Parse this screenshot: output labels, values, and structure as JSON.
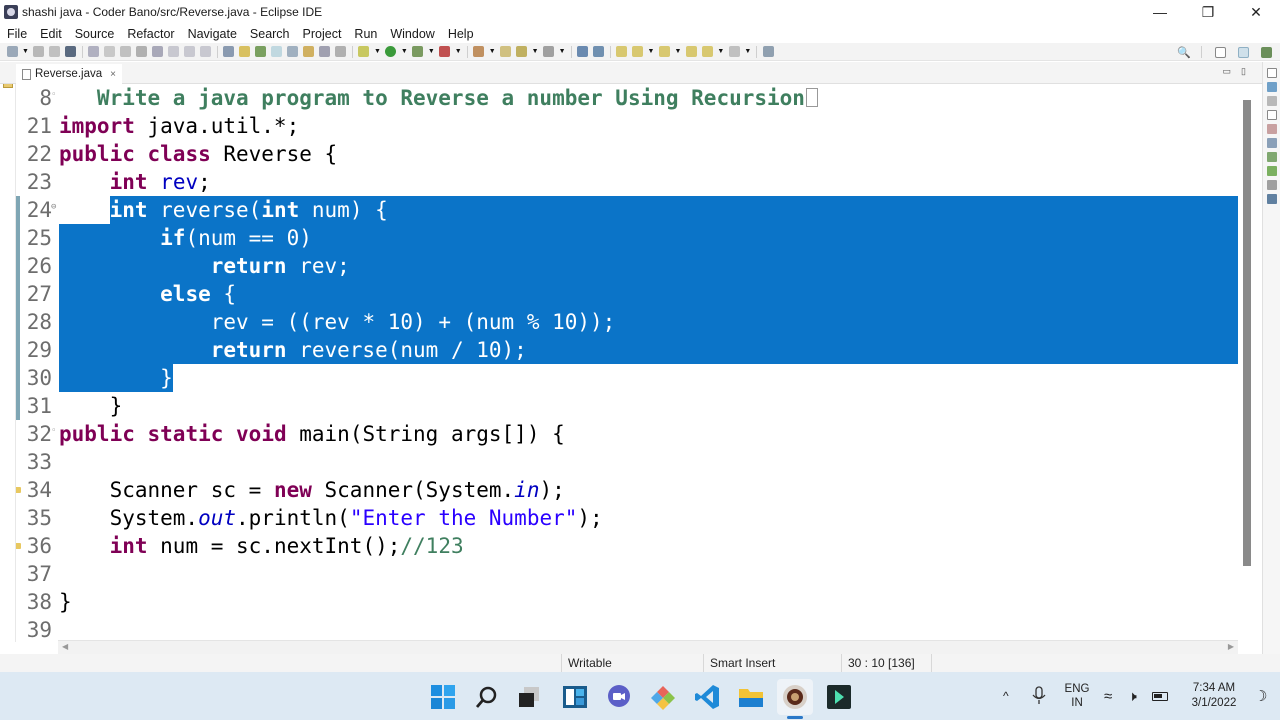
{
  "window": {
    "title": "shashi java - Coder Bano/src/Reverse.java - Eclipse IDE",
    "controls": {
      "minimize": "—",
      "maximize": "❐",
      "close": "✕"
    }
  },
  "menubar": [
    "File",
    "Edit",
    "Source",
    "Refactor",
    "Navigate",
    "Search",
    "Project",
    "Run",
    "Window",
    "Help"
  ],
  "toolbar": {
    "icons": [
      "new-icon",
      "save-icon",
      "save-all-icon",
      "terminal-icon",
      "skip-breakpoints-icon",
      "resume-icon",
      "suspend-icon",
      "terminate-icon",
      "disconnect-icon",
      "step-into-icon",
      "step-over-icon",
      "step-return-icon",
      "toggle-comment-icon",
      "format-icon",
      "open-type-icon",
      "mark-occurrences-icon",
      "highlight-icon",
      "toggle-block-icon",
      "show-whitespace-icon",
      "paragraph-icon",
      "debug-icon",
      "run-icon",
      "run-coverage-icon",
      "external-tools-icon",
      "new-java-project-icon",
      "new-package-icon",
      "new-class-icon",
      "open-task-icon",
      "search-web-icon",
      "breadcrumb-icon",
      "next-annotation-icon",
      "prev-annotation-icon",
      "back-icon",
      "forward-icon",
      "last-edit-icon",
      "pin-icon",
      "open-perspective-icon"
    ],
    "right": [
      "search-icon",
      "open-perspective-icon",
      "java-perspective-icon",
      "debug-perspective-icon"
    ]
  },
  "editor_tab": {
    "label": "Reverse.java",
    "close": "×"
  },
  "code_lines": [
    {
      "num": "8",
      "fold": "◦",
      "tokens": [
        [
          "jdoc",
          "   Write a java program to Reverse a number Using Recursion"
        ]
      ],
      "box": true
    },
    {
      "num": "21",
      "tokens": [
        [
          "kw",
          "import"
        ],
        [
          "",
          " java.util.*;"
        ]
      ]
    },
    {
      "num": "22",
      "tokens": [
        [
          "kw",
          "public"
        ],
        [
          "",
          " "
        ],
        [
          "kw",
          "class"
        ],
        [
          "",
          " Reverse {"
        ]
      ]
    },
    {
      "num": "23",
      "tokens": [
        [
          "",
          "    "
        ],
        [
          "kw",
          "int"
        ],
        [
          "",
          " "
        ],
        [
          "field",
          "rev"
        ],
        [
          "",
          ";"
        ]
      ]
    },
    {
      "num": "24",
      "fold": "⊖",
      "tokens": [
        [
          "",
          "    "
        ],
        [
          "kw",
          "int"
        ],
        [
          "",
          " reverse("
        ],
        [
          "kw",
          "int"
        ],
        [
          "",
          " num) {"
        ]
      ],
      "sel": true
    },
    {
      "num": "25",
      "tokens": [
        [
          "",
          "        "
        ],
        [
          "kw",
          "if"
        ],
        [
          "",
          "(num == 0)"
        ]
      ],
      "sel": true
    },
    {
      "num": "26",
      "tokens": [
        [
          "",
          "            "
        ],
        [
          "kw",
          "return"
        ],
        [
          "",
          " "
        ],
        [
          "field",
          "rev"
        ],
        [
          "",
          ";"
        ]
      ],
      "sel": true
    },
    {
      "num": "27",
      "tokens": [
        [
          "",
          "        "
        ],
        [
          "kw",
          "else"
        ],
        [
          "",
          " {"
        ]
      ],
      "sel": true
    },
    {
      "num": "28",
      "tokens": [
        [
          "",
          "            "
        ],
        [
          "field",
          "rev"
        ],
        [
          "",
          " = (("
        ],
        [
          "field",
          "rev"
        ],
        [
          "",
          " * 10) + (num % 10));"
        ]
      ],
      "sel": true
    },
    {
      "num": "29",
      "tokens": [
        [
          "",
          "            "
        ],
        [
          "kw",
          "return"
        ],
        [
          "",
          " reverse(num / 10);"
        ]
      ],
      "sel": true
    },
    {
      "num": "30",
      "tokens": [
        [
          "",
          "        }"
        ]
      ],
      "sel": true
    },
    {
      "num": "31",
      "tokens": [
        [
          "",
          "    }"
        ]
      ]
    },
    {
      "num": "32",
      "fold": "◦",
      "tokens": [
        [
          "kw",
          "public"
        ],
        [
          "",
          " "
        ],
        [
          "kw",
          "static"
        ],
        [
          "",
          " "
        ],
        [
          "kw",
          "void"
        ],
        [
          "",
          " main(String args[]) {"
        ]
      ]
    },
    {
      "num": "33",
      "tokens": [
        [
          "",
          ""
        ]
      ]
    },
    {
      "num": "34",
      "marker": true,
      "tokens": [
        [
          "",
          "    Scanner sc = "
        ],
        [
          "kw",
          "new"
        ],
        [
          "",
          " Scanner(System."
        ],
        [
          "static",
          "in"
        ],
        [
          "",
          ");"
        ]
      ]
    },
    {
      "num": "35",
      "tokens": [
        [
          "",
          "    System."
        ],
        [
          "static",
          "out"
        ],
        [
          "",
          ".println("
        ],
        [
          "str",
          "\"Enter the Number\""
        ],
        [
          "",
          ");"
        ]
      ]
    },
    {
      "num": "36",
      "marker": true,
      "tokens": [
        [
          "",
          "    "
        ],
        [
          "kw",
          "int"
        ],
        [
          "",
          " num = sc.nextInt();"
        ],
        [
          "comment",
          "//123"
        ]
      ]
    },
    {
      "num": "37",
      "tokens": [
        [
          "",
          ""
        ]
      ]
    },
    {
      "num": "38",
      "tokens": [
        [
          "",
          "}"
        ]
      ]
    },
    {
      "num": "39",
      "tokens": [
        [
          "",
          ""
        ]
      ]
    }
  ],
  "status": {
    "writable": "Writable",
    "insert_mode": "Smart Insert",
    "position": "30 : 10 [136]"
  },
  "taskbar": {
    "apps": [
      "start-icon",
      "search-icon",
      "task-view-icon",
      "widgets-icon",
      "teams-chat-icon",
      "photos-icon",
      "vscode-icon",
      "file-explorer-icon",
      "eclipse-icon",
      "filmora-icon"
    ],
    "tray": {
      "chevron": "^",
      "language_top": "ENG",
      "language_bottom": "IN",
      "time": "7:34 AM",
      "date": "3/1/2022"
    }
  },
  "colors": {
    "selection": "#0b74c8",
    "keyword": "#7f0055",
    "field": "#0000c0",
    "string": "#2a00ff",
    "comment": "#3f7f5f"
  }
}
